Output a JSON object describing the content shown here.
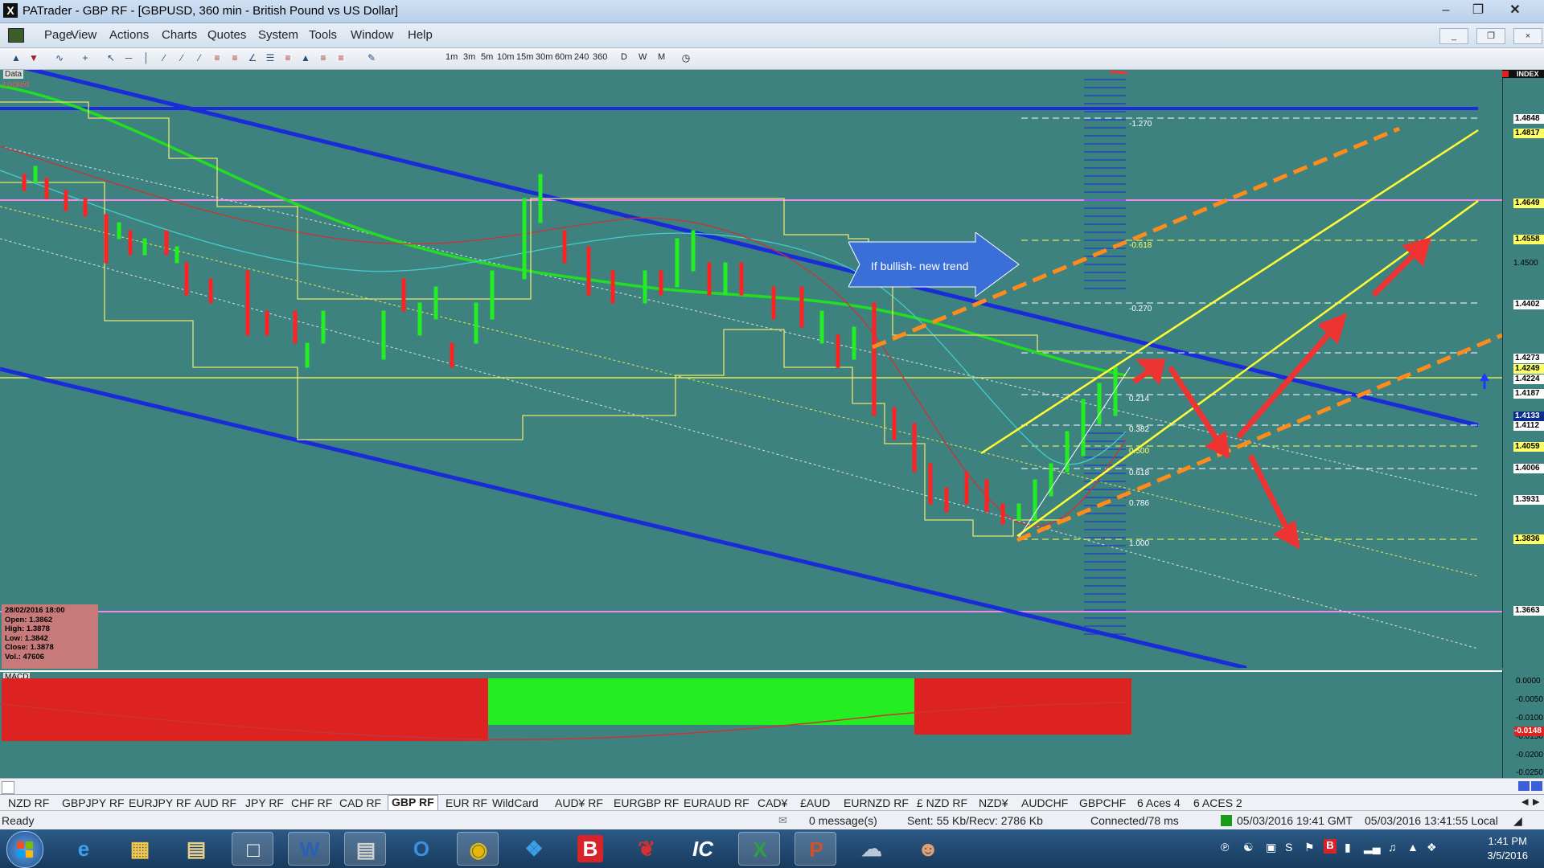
{
  "window": {
    "title": "PATrader - GBP RF - [GBPUSD, 360 min - British Pound vs US Dollar]",
    "app_icon": "X"
  },
  "menu": [
    "Page",
    "View",
    "Actions",
    "Charts",
    "Quotes",
    "System",
    "Tools",
    "Window",
    "Help"
  ],
  "timeframes": [
    "1m",
    "3m",
    "5m",
    "10m",
    "15m",
    "30m",
    "60m",
    "240",
    "360",
    "D",
    "W",
    "M"
  ],
  "chart": {
    "corner_labels": [
      "Data",
      "Locked"
    ],
    "index_label": "INDEX",
    "annotation": "If bullish- new trend",
    "fib_labels": [
      {
        "text": "-1.270"
      },
      {
        "text": "-0.618"
      },
      {
        "text": "-0.270"
      },
      {
        "text": "0.214"
      },
      {
        "text": "0.382"
      },
      {
        "text": "0.500"
      },
      {
        "text": "0.618"
      },
      {
        "text": "0.786"
      },
      {
        "text": "1.000"
      }
    ],
    "price_tags": [
      {
        "value": "1.4848",
        "color": "#ffffff"
      },
      {
        "value": "1.4817",
        "color": "#ffff66"
      },
      {
        "value": "1.4649",
        "color": "#ffff66"
      },
      {
        "value": "1.4558",
        "color": "#ffff66"
      },
      {
        "value": "1.4402",
        "color": "#ffffff"
      },
      {
        "value": "1.4273",
        "color": "#ffffff"
      },
      {
        "value": "1.4249",
        "color": "#ffff66"
      },
      {
        "value": "1.4224",
        "color": "#ffffff"
      },
      {
        "value": "1.4187",
        "color": "#ffffff"
      },
      {
        "value": "1.4133",
        "color": "#0a2f8a"
      },
      {
        "value": "1.4112",
        "color": "#ffffff"
      },
      {
        "value": "1.4059",
        "color": "#ffff66"
      },
      {
        "value": "1.4006",
        "color": "#ffffff"
      },
      {
        "value": "1.3931",
        "color": "#ffffff"
      },
      {
        "value": "1.3836",
        "color": "#ffff66"
      },
      {
        "value": "1.3663",
        "color": "#ffffff"
      }
    ],
    "axis_labels": [
      "1.4500"
    ],
    "ohlc": {
      "date": "28/02/2016 18:00",
      "open": "Open: 1.3862",
      "high": "High: 1.3878",
      "low": "Low: 1.3842",
      "close": "Close: 1.3878",
      "vol": "Vol.: 47606"
    }
  },
  "macd": {
    "label": "MACD",
    "axis": [
      "0.0000",
      "-0.0050",
      "-0.0100",
      "-0.0150",
      "-0.0200",
      "-0.0250"
    ],
    "current": "-0.0148"
  },
  "tabs": [
    "NZD RF",
    "GBPJPY RF",
    "EURJPY RF",
    "AUD RF",
    "JPY RF",
    "CHF RF",
    "CAD RF",
    "GBP RF",
    "EUR RF",
    "WildCard",
    "AUD¥ RF",
    "EURGBP RF",
    "EURAUD RF",
    "CAD¥",
    "£AUD",
    "EURNZD RF",
    "£ NZD RF",
    "NZD¥",
    "AUDCHF",
    "GBPCHF",
    "6 Aces 4",
    "6 ACES 2"
  ],
  "active_tab": "GBP RF",
  "status": {
    "ready": "Ready",
    "messages": "0 message(s)",
    "traffic": "Sent: 55 Kb/Recv: 2786 Kb",
    "connection": "Connected/78 ms",
    "gmt": "05/03/2016 19:41 GMT",
    "local": "05/03/2016 13:41:55 Local"
  },
  "taskbar": {
    "time": "1:41 PM",
    "date": "3/5/2016"
  }
}
